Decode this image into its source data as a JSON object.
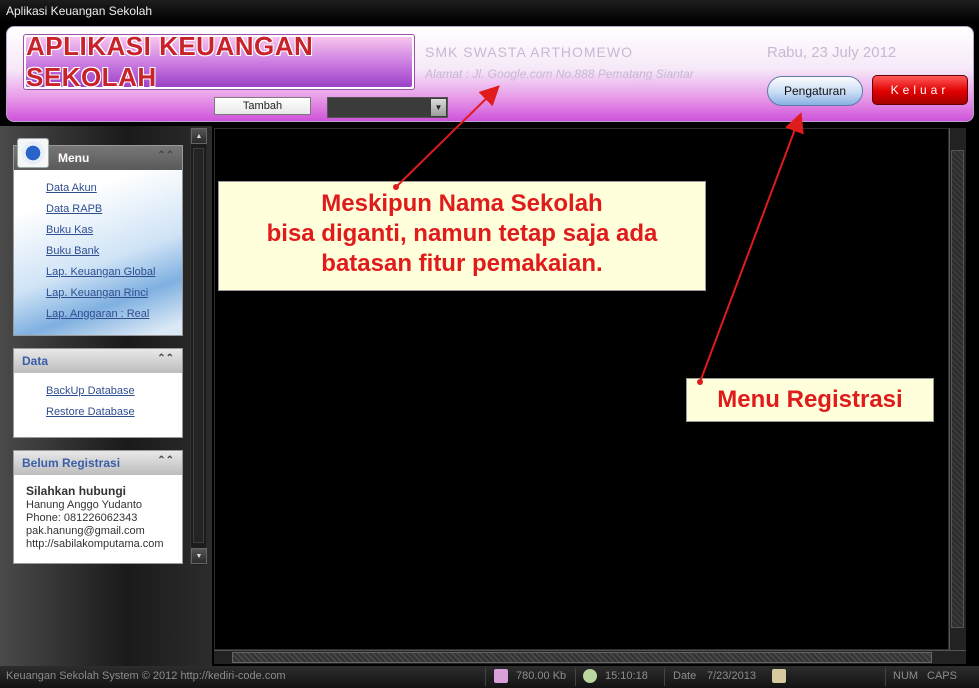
{
  "window": {
    "title": "Aplikasi Keuangan Sekolah"
  },
  "header": {
    "logo_text": "APLIKASI KEUANGAN SEKOLAH",
    "school_name": "SMK SWASTA ARTHOMEWO",
    "school_address": "Alamat : Jl. Google.com No.888 Pematang Siantar",
    "date": "Rabu, 23 July 2012",
    "add_button": "Tambah",
    "combo_value": "",
    "settings_button": "Pengaturan",
    "exit_button": "Keluar"
  },
  "sidebar": {
    "menu": {
      "title": "Menu",
      "items": [
        "Data Akun",
        "Data RAPB",
        "Buku Kas",
        "Buku Bank",
        "Lap. Keuangan Global",
        "Lap. Keuangan Rinci",
        "Lap. Anggaran : Real"
      ]
    },
    "data": {
      "title": "Data",
      "items": [
        "BackUp Database",
        "Restore Database"
      ]
    },
    "registration": {
      "title": "Belum Registrasi",
      "contact_heading": "Silahkan hubungi",
      "contact_name": "Hanung Anggo Yudanto",
      "phone": "Phone: 081226062343",
      "email": "pak.hanung@gmail.com",
      "website": "http://sabilakomputama.com"
    }
  },
  "callouts": {
    "school_name_note": [
      "Meskipun Nama Sekolah",
      "bisa diganti, namun tetap saja ada",
      "batasan fitur pemakaian."
    ],
    "registration_note": "Menu Registrasi"
  },
  "statusbar": {
    "copyright": "Keuangan Sekolah System © 2012 http://kediri-code.com",
    "memory": "780.00 Kb",
    "time": "15:10:18",
    "date_label": "Date",
    "date": "7/23/2013",
    "num": "NUM",
    "caps": "CAPS"
  },
  "colors": {
    "accent": "#cf52db",
    "callout_text": "#e01b1b",
    "exit": "#e00000"
  }
}
